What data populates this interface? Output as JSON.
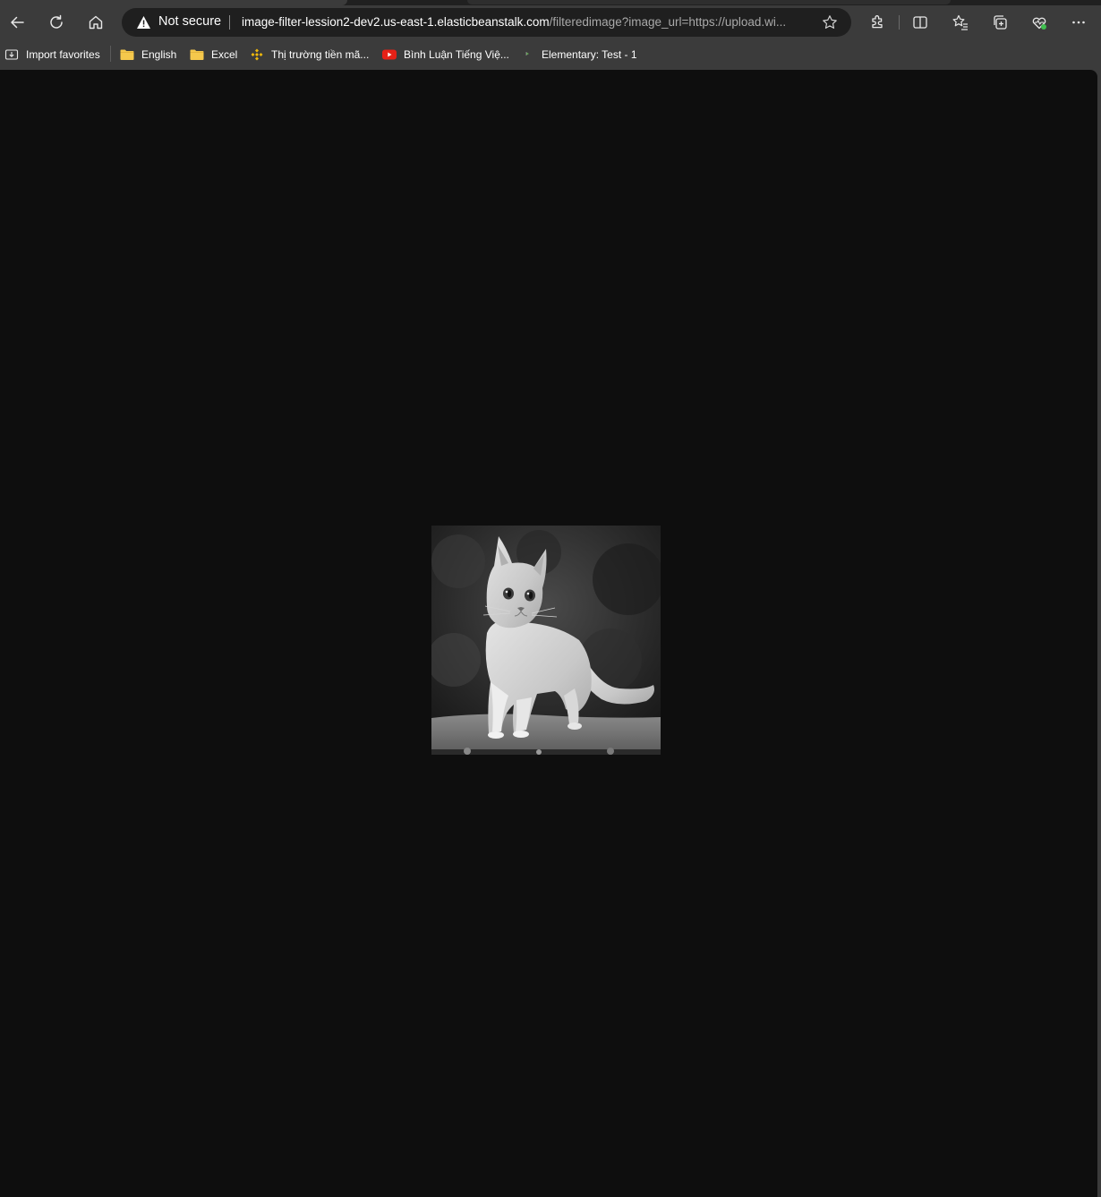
{
  "browser": {
    "security": {
      "label": "Not secure",
      "icon": "warning-icon"
    },
    "address": {
      "host": "image-filter-lession2-dev2.us-east-1.elasticbeanstalk.com",
      "path": "/filteredimage?image_url=https://upload.wi..."
    },
    "toolbar_icons": [
      "back-arrow-icon",
      "refresh-icon",
      "home-icon",
      "star-icon",
      "extensions-icon",
      "split-screen-icon",
      "favorites-icon",
      "collections-icon",
      "browser-essentials-icon",
      "more-icon"
    ]
  },
  "favorites": [
    {
      "label": "Import favorites",
      "icon": "import-icon"
    },
    {
      "label": "English",
      "icon": "folder-icon"
    },
    {
      "label": "Excel",
      "icon": "folder-icon"
    },
    {
      "label": "Thị trường tiền mã...",
      "icon": "binance-icon"
    },
    {
      "label": "Bình Luận Tiếng Việ...",
      "icon": "youtube-icon"
    },
    {
      "label": "Elementary: Test - 1",
      "icon": "site-icon"
    }
  ],
  "page": {
    "image": "grayscale photo of a kitten standing on a stone ledge"
  },
  "colors": {
    "chrome": "#3b3b3b",
    "omnibox": "#1f1f1f",
    "page_background": "#0e0e0e",
    "folder": "#f5c84c",
    "youtube": "#e62117",
    "binance": "#f0b90b"
  }
}
